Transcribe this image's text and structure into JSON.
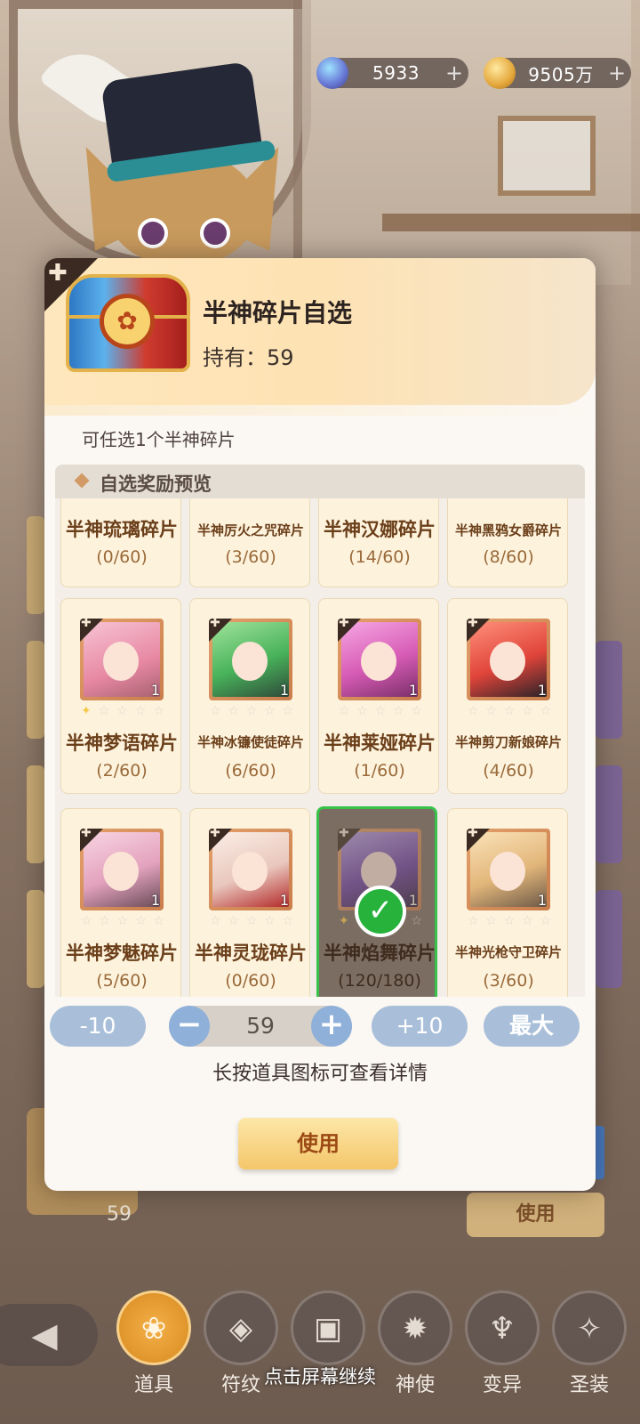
{
  "currency": {
    "gem": {
      "value": "5933",
      "icon": "gem-icon"
    },
    "gold": {
      "value": "9505万",
      "icon": "gold-coin-icon"
    },
    "plus": "+"
  },
  "dialog": {
    "title": "半神碎片自选",
    "owned": "持有：59",
    "hint": "可任选1个半神碎片",
    "preview_title": "自选奖励预览",
    "items": [
      {
        "name": "半神琉璃碎片",
        "count": "(0/60)",
        "small": false
      },
      {
        "name": "半神厉火之咒碎片",
        "count": "(3/60)",
        "small": true
      },
      {
        "name": "半神汉娜碎片",
        "count": "(14/60)",
        "small": false
      },
      {
        "name": "半神黑鸦女爵碎片",
        "count": "(8/60)",
        "small": true
      },
      {
        "name": "半神梦语碎片",
        "count": "(2/60)",
        "small": false,
        "qty": "1",
        "stars": 1
      },
      {
        "name": "半神冰镰使徒碎片",
        "count": "(6/60)",
        "small": true,
        "qty": "1",
        "stars": 0
      },
      {
        "name": "半神莱娅碎片",
        "count": "(1/60)",
        "small": false,
        "qty": "1",
        "stars": 0
      },
      {
        "name": "半神剪刀新娘碎片",
        "count": "(4/60)",
        "small": true,
        "qty": "1",
        "stars": 0
      },
      {
        "name": "半神梦魅碎片",
        "count": "(5/60)",
        "small": false,
        "qty": "1",
        "stars": 0
      },
      {
        "name": "半神灵珑碎片",
        "count": "(0/60)",
        "small": false,
        "qty": "1",
        "stars": 0
      },
      {
        "name": "半神焰舞碎片",
        "count": "(120/180)",
        "small": false,
        "qty": "1",
        "stars": 1,
        "selected": true
      },
      {
        "name": "半神光枪守卫碎片",
        "count": "(3/60)",
        "small": true,
        "qty": "1",
        "stars": 0
      }
    ],
    "quantity": {
      "minus10": "-10",
      "plus10": "+10",
      "max": "最大",
      "value": "59",
      "minus": "−",
      "plus": "+"
    },
    "press_tip": "长按道具图标可查看详情",
    "use_label": "使用"
  },
  "background": {
    "behind_count": "59",
    "behind_use": "使用"
  },
  "nav": {
    "back": "◀",
    "items": [
      {
        "label": "道具",
        "icon": "bag-icon",
        "active": true
      },
      {
        "label": "符纹",
        "icon": "dice-icon",
        "active": false
      },
      {
        "label": "",
        "icon": "card-icon",
        "active": false
      },
      {
        "label": "神使",
        "icon": "spirit-icon",
        "active": false
      },
      {
        "label": "变异",
        "icon": "mutation-icon",
        "active": false
      },
      {
        "label": "圣装",
        "icon": "holy-gear-icon",
        "active": false
      }
    ],
    "continue_text": "点击屏幕继续"
  }
}
